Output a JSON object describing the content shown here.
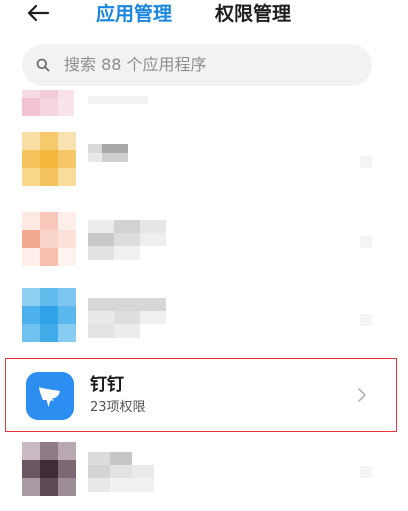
{
  "header": {
    "tabs": [
      {
        "label": "应用管理",
        "active": true
      },
      {
        "label": "权限管理",
        "active": false
      }
    ]
  },
  "search": {
    "placeholder": "搜索 88 个应用程序"
  },
  "apps": [
    {
      "name": "钉钉",
      "subtitle": "23项权限",
      "icon": "dingtalk-icon",
      "highlighted": true
    }
  ],
  "colors": {
    "accent": "#1a86e2",
    "highlight_border": "#e4393c",
    "dingtalk_blue": "#2c8ef0"
  }
}
